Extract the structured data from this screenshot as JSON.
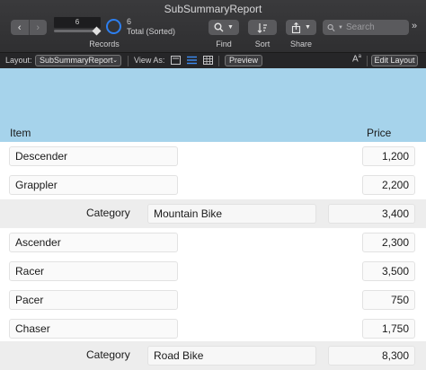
{
  "window": {
    "title": "SubSummaryReport"
  },
  "toolbar": {
    "nav_back": "‹",
    "nav_forward": "›",
    "record_current": "6",
    "record_count": "6",
    "record_status": "Total (Sorted)",
    "records_label": "Records",
    "find_label": "Find",
    "sort_label": "Sort",
    "share_label": "Share",
    "search_placeholder": "Search",
    "overflow": "»"
  },
  "layoutbar": {
    "layout_label": "Layout:",
    "layout_value": "SubSummaryReport",
    "view_as_label": "View As:",
    "preview_button": "Preview",
    "edit_layout_button": "Edit Layout"
  },
  "report": {
    "header_item": "Item",
    "header_price": "Price",
    "rows": [
      {
        "type": "record",
        "item": "Descender",
        "price": "1,200"
      },
      {
        "type": "record",
        "item": "Grappler",
        "price": "2,200"
      },
      {
        "type": "summary",
        "label": "Category",
        "category": "Mountain Bike",
        "total": "3,400"
      },
      {
        "type": "record",
        "item": "Ascender",
        "price": "2,300"
      },
      {
        "type": "record",
        "item": "Racer",
        "price": "3,500"
      },
      {
        "type": "record",
        "item": "Pacer",
        "price": "750"
      },
      {
        "type": "record",
        "item": "Chaser",
        "price": "1,750"
      },
      {
        "type": "summary",
        "label": "Category",
        "category": "Road Bike",
        "total": "8,300"
      }
    ]
  },
  "colors": {
    "header_band": "#a6d3eb",
    "pie_accent": "#2d7ff0",
    "summary_band": "#ededed"
  }
}
